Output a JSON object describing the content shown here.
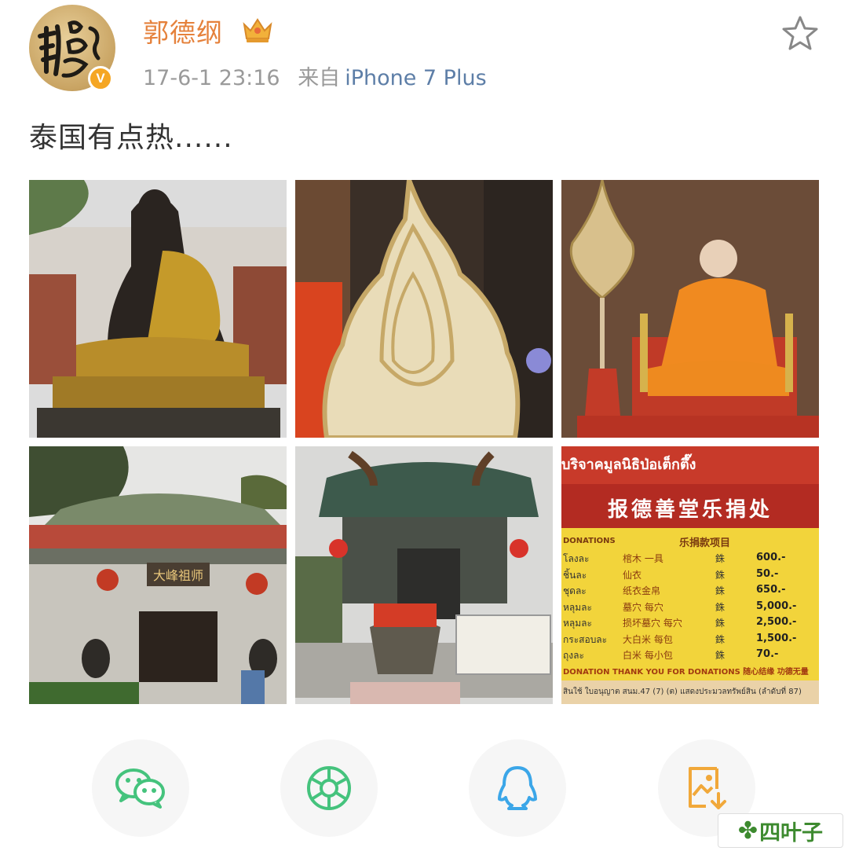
{
  "post": {
    "author": "郭德纲",
    "verified_badge": "V",
    "timestamp": "17-6-1 23:16",
    "source_prefix": "来自",
    "device": "iPhone 7 Plus",
    "text": "泰国有点热......",
    "favorite_icon": "star-outline-icon",
    "member_icon": "crown-icon"
  },
  "photos": [
    {
      "label": "sitting-buddha-statue"
    },
    {
      "label": "golden-leaf-ornament"
    },
    {
      "label": "monk-portrait"
    },
    {
      "label": "chinese-shrine-gate"
    },
    {
      "label": "temple-incense-altar"
    },
    {
      "label": "donation-price-board"
    }
  ],
  "donation_board": {
    "thai_header": "บริจาคมูลนิธิป่อเต็กตึ๊ง",
    "chinese_header": "报德善堂乐捐处",
    "left_heading": "DONATIONS",
    "list_heading": "乐捐款项目",
    "rows": [
      {
        "thai": "โลงละ",
        "item": "棺木 一具",
        "unit": "銖",
        "amount": "600.-"
      },
      {
        "thai": "ชิ้นละ",
        "item": "仙衣",
        "unit": "銖",
        "amount": "50.-"
      },
      {
        "thai": "ชุดละ",
        "item": "纸衣金帛",
        "unit": "銖",
        "amount": "650.-"
      },
      {
        "thai": "หลุมละ",
        "item": "墓穴 每穴",
        "unit": "銖",
        "amount": "5,000.-"
      },
      {
        "thai": "หลุมละ",
        "item": "损坏墓穴 每穴",
        "unit": "銖",
        "amount": "2,500.-"
      },
      {
        "thai": "กระสอบละ",
        "item": "大白米 每包",
        "unit": "銖",
        "amount": "1,500.-"
      },
      {
        "thai": "ถุงละ",
        "item": "白米 每小包",
        "unit": "銖",
        "amount": "70.-"
      }
    ],
    "footer": "DONATION THANK YOU FOR DONATIONS 随心结缘 功德无量",
    "bottom_line": "ใบอนุญาต สนม.47 (7) (ต) แสดงประมวลทรัพย์สิน (ลำดับที่ 87)",
    "bottom_line_start": "สินใช้"
  },
  "shrine_sign": "大峰祖师",
  "share": [
    {
      "name": "wechat",
      "icon": "wechat-icon",
      "color": "#45c37d"
    },
    {
      "name": "moments",
      "icon": "wechat-moments-icon",
      "color": "#45c37d"
    },
    {
      "name": "qq",
      "icon": "qq-icon",
      "color": "#3ba6e8"
    },
    {
      "name": "save-image",
      "icon": "save-image-icon",
      "color": "#f1a83a"
    }
  ],
  "watermark": "四叶子",
  "watermark_icon": "clover-icon",
  "colors": {
    "username": "#e5813b",
    "device_link": "#5d7ea7",
    "meta": "#9a9a9a",
    "text": "#333333",
    "badge": "#f5a623"
  }
}
